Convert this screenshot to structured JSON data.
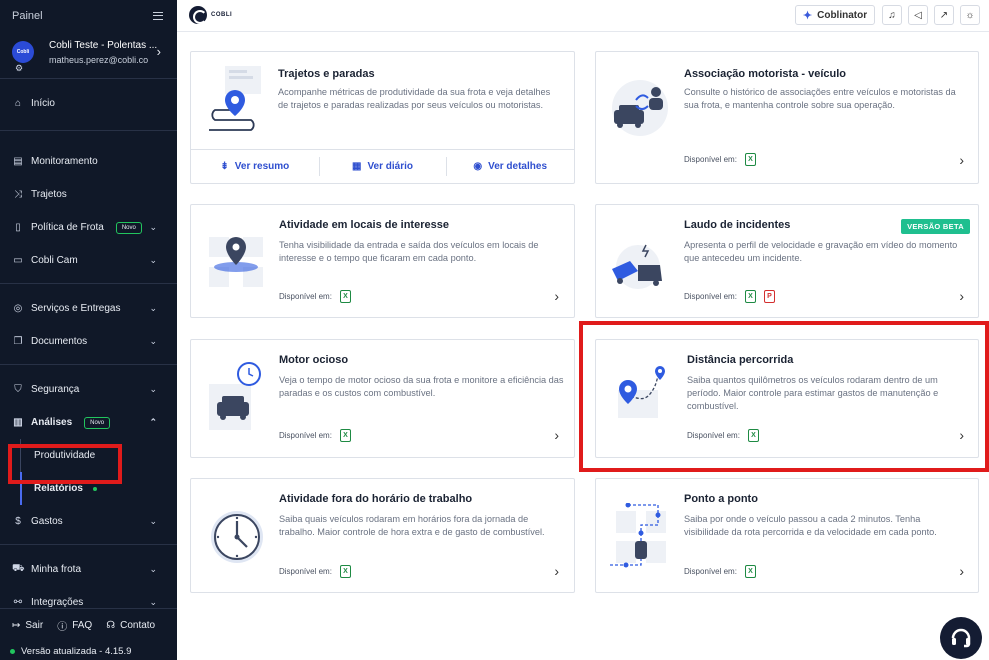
{
  "sidebar": {
    "title": "Painel",
    "account": {
      "name": "Cobli Teste - Polentas ...",
      "email": "matheus.perez@cobli.co",
      "logo_text": "Cobli"
    },
    "items": [
      {
        "label": "Início",
        "icon": "home-icon"
      },
      {
        "label": "Monitoramento",
        "icon": "map-icon"
      },
      {
        "label": "Trajetos",
        "icon": "route-icon"
      },
      {
        "label": "Política de Frota",
        "icon": "document-icon",
        "badge": "Novo"
      },
      {
        "label": "Cobli Cam",
        "icon": "camera-icon"
      },
      {
        "label": "Serviços e Entregas",
        "icon": "pin-icon"
      },
      {
        "label": "Documentos",
        "icon": "files-icon"
      },
      {
        "label": "Segurança",
        "icon": "shield-icon"
      },
      {
        "label": "Análises",
        "icon": "chart-icon",
        "badge": "Novo"
      },
      {
        "label": "Gastos",
        "icon": "dollar-icon"
      },
      {
        "label": "Minha frota",
        "icon": "truck-icon"
      },
      {
        "label": "Integrações",
        "icon": "integration-icon"
      }
    ],
    "subitems": [
      {
        "label": "Produtividade"
      },
      {
        "label": "Relatórios"
      }
    ],
    "bottom": {
      "exit": "Sair",
      "faq": "FAQ",
      "contact": "Contato",
      "version": "Versão atualizada - 4.15.9"
    }
  },
  "header": {
    "logo_text": "COBLI",
    "coblinator": "Coblinator"
  },
  "cards": [
    {
      "title": "Trajetos e paradas",
      "desc": "Acompanhe métricas de produtividade da sua frota e veja detalhes de trajetos e paradas realizadas por seus veículos ou motoristas.",
      "actions": [
        "Ver resumo",
        "Ver diário",
        "Ver detalhes"
      ]
    },
    {
      "title": "Associação motorista - veículo",
      "desc": "Consulte o histórico de associações entre veículos e motoristas da sua frota, e mantenha controle sobre sua operação.",
      "avail": "Disponível em:"
    },
    {
      "title": "Atividade em locais de interesse",
      "desc": "Tenha visibilidade da entrada e saída dos veículos em locais de interesse e o tempo que ficaram em cada ponto.",
      "avail": "Disponível em:"
    },
    {
      "title": "Laudo de incidentes",
      "desc": "Apresenta o perfil de velocidade e gravação em vídeo do momento que antecedeu um incidente.",
      "avail": "Disponível em:",
      "badge": "VERSÃO BETA"
    },
    {
      "title": "Motor ocioso",
      "desc": "Veja o tempo de motor ocioso da sua frota e monitore a eficiência das paradas e os custos com combustível.",
      "avail": "Disponível em:"
    },
    {
      "title": "Distância percorrida",
      "desc": "Saiba quantos quilômetros os veículos rodaram dentro de um período. Maior controle para estimar gastos de manutenção e combustível.",
      "avail": "Disponível em:"
    },
    {
      "title": "Atividade fora do horário de trabalho",
      "desc": "Saiba quais veículos rodaram em horários fora da jornada de trabalho. Maior controle de hora extra e de gasto de combustível.",
      "avail": "Disponível em:"
    },
    {
      "title": "Ponto a ponto",
      "desc": "Saiba por onde o veículo passou a cada 2 minutos. Tenha visibilidade da rota percorrida e da velocidade em cada ponto.",
      "avail": "Disponível em:"
    }
  ],
  "colors": {
    "sidebar_bg": "#101828",
    "accent": "#2f4fcf",
    "badge_green": "#22c55e",
    "highlight_red": "#e01b1b"
  }
}
